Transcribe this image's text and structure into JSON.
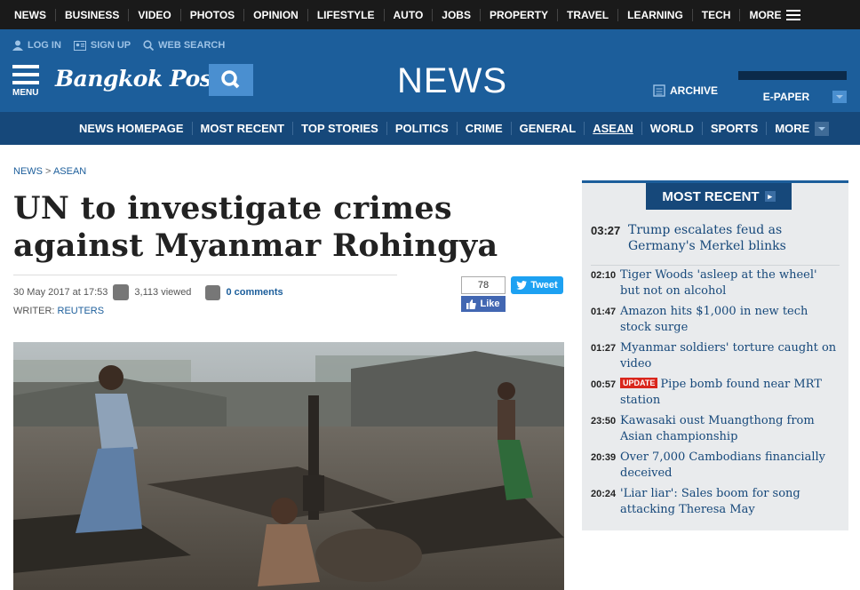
{
  "top_nav": [
    "NEWS",
    "BUSINESS",
    "VIDEO",
    "PHOTOS",
    "OPINION",
    "LIFESTYLE",
    "AUTO",
    "JOBS",
    "PROPERTY",
    "TRAVEL",
    "LEARNING",
    "TECH"
  ],
  "top_nav_more": "MORE",
  "header": {
    "login": "LOG IN",
    "signup": "SIGN UP",
    "web_search": "WEB SEARCH",
    "menu": "MENU",
    "logo": "Bangkok Post",
    "section": "NEWS",
    "archive": "ARCHIVE",
    "epaper": "E-PAPER"
  },
  "sub_nav": [
    {
      "label": "NEWS HOMEPAGE",
      "active": false
    },
    {
      "label": "MOST RECENT",
      "active": false
    },
    {
      "label": "TOP STORIES",
      "active": false
    },
    {
      "label": "POLITICS",
      "active": false
    },
    {
      "label": "CRIME",
      "active": false
    },
    {
      "label": "GENERAL",
      "active": false
    },
    {
      "label": "ASEAN",
      "active": true
    },
    {
      "label": "WORLD",
      "active": false
    },
    {
      "label": "SPORTS",
      "active": false
    }
  ],
  "sub_nav_more": "MORE",
  "breadcrumb": {
    "root": "NEWS",
    "sep": " > ",
    "current": "ASEAN"
  },
  "article": {
    "title": "UN to investigate crimes against Myanmar Rohingya",
    "date": "30 May 2017 at 17:53",
    "views": "3,113 viewed",
    "comments": "0 comments",
    "writer_label": "WRITER: ",
    "writer": "REUTERS"
  },
  "social": {
    "like_count": "78",
    "like": "Like",
    "tweet": "Tweet"
  },
  "most_recent": {
    "heading": "MOST RECENT",
    "lead": {
      "time": "03:27",
      "headline": "Trump escalates feud as Germany's Merkel blinks"
    },
    "items": [
      {
        "time": "02:10",
        "headline": "Tiger Woods 'asleep at the wheel' but not on alcohol",
        "badge": ""
      },
      {
        "time": "01:47",
        "headline": "Amazon hits $1,000 in new tech stock surge",
        "badge": ""
      },
      {
        "time": "01:27",
        "headline": "Myanmar soldiers' torture caught on video",
        "badge": ""
      },
      {
        "time": "00:57",
        "headline": "Pipe bomb found near MRT station",
        "badge": "UPDATE"
      },
      {
        "time": "23:50",
        "headline": "Kawasaki oust Muangthong from Asian championship",
        "badge": ""
      },
      {
        "time": "20:39",
        "headline": "Over 7,000 Cambodians financially deceived",
        "badge": ""
      },
      {
        "time": "20:24",
        "headline": "'Liar liar': Sales boom for song attacking Theresa May",
        "badge": ""
      }
    ]
  },
  "colors": {
    "brand_blue": "#1c5e9b",
    "dark_blue": "#16487a",
    "top_bar": "#1a1a1a",
    "update_red": "#d9261c"
  }
}
